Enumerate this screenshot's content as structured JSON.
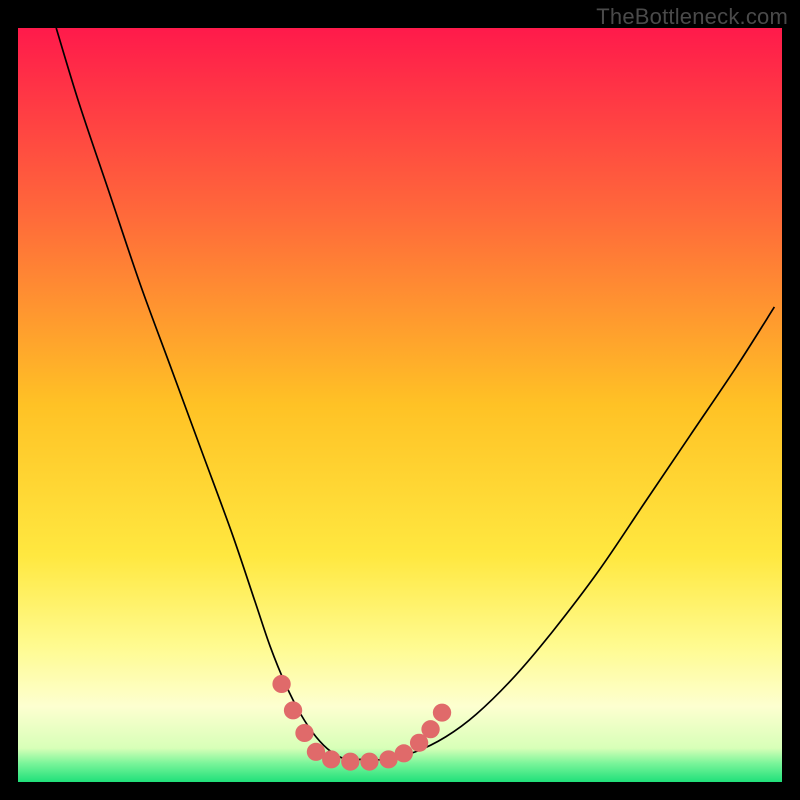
{
  "watermark": "TheBottleneck.com",
  "chart_data": {
    "type": "line",
    "title": "",
    "xlabel": "",
    "ylabel": "",
    "xlim": [
      0,
      100
    ],
    "ylim": [
      0,
      100
    ],
    "grid": false,
    "legend": false,
    "background_gradient_stops": [
      {
        "offset": 0.0,
        "color": "#ff1a4b"
      },
      {
        "offset": 0.25,
        "color": "#ff6a3a"
      },
      {
        "offset": 0.5,
        "color": "#ffc225"
      },
      {
        "offset": 0.7,
        "color": "#ffe840"
      },
      {
        "offset": 0.82,
        "color": "#fffb90"
      },
      {
        "offset": 0.9,
        "color": "#fdffd0"
      },
      {
        "offset": 0.955,
        "color": "#d8ffb8"
      },
      {
        "offset": 0.975,
        "color": "#7bf59a"
      },
      {
        "offset": 1.0,
        "color": "#20e07a"
      }
    ],
    "series": [
      {
        "name": "bottleneck-curve",
        "color": "#000000",
        "x": [
          5,
          8,
          12,
          16,
          20,
          24,
          28,
          31,
          33,
          35,
          37,
          39,
          41,
          43,
          45,
          48,
          52,
          56,
          60,
          65,
          70,
          76,
          82,
          88,
          94,
          99
        ],
        "y": [
          100,
          90,
          78,
          66,
          55,
          44,
          33,
          24,
          18,
          13,
          9,
          6,
          4,
          3,
          3,
          3,
          4,
          6,
          9,
          14,
          20,
          28,
          37,
          46,
          55,
          63
        ]
      }
    ],
    "markers": {
      "name": "valley-markers",
      "color": "#e06a6a",
      "radius_norm": 0.012,
      "points": [
        {
          "x": 34.5,
          "y": 13.0
        },
        {
          "x": 36.0,
          "y": 9.5
        },
        {
          "x": 37.5,
          "y": 6.5
        },
        {
          "x": 39.0,
          "y": 4.0
        },
        {
          "x": 41.0,
          "y": 3.0
        },
        {
          "x": 43.5,
          "y": 2.7
        },
        {
          "x": 46.0,
          "y": 2.7
        },
        {
          "x": 48.5,
          "y": 3.0
        },
        {
          "x": 50.5,
          "y": 3.8
        },
        {
          "x": 52.5,
          "y": 5.2
        },
        {
          "x": 54.0,
          "y": 7.0
        },
        {
          "x": 55.5,
          "y": 9.2
        }
      ]
    }
  }
}
